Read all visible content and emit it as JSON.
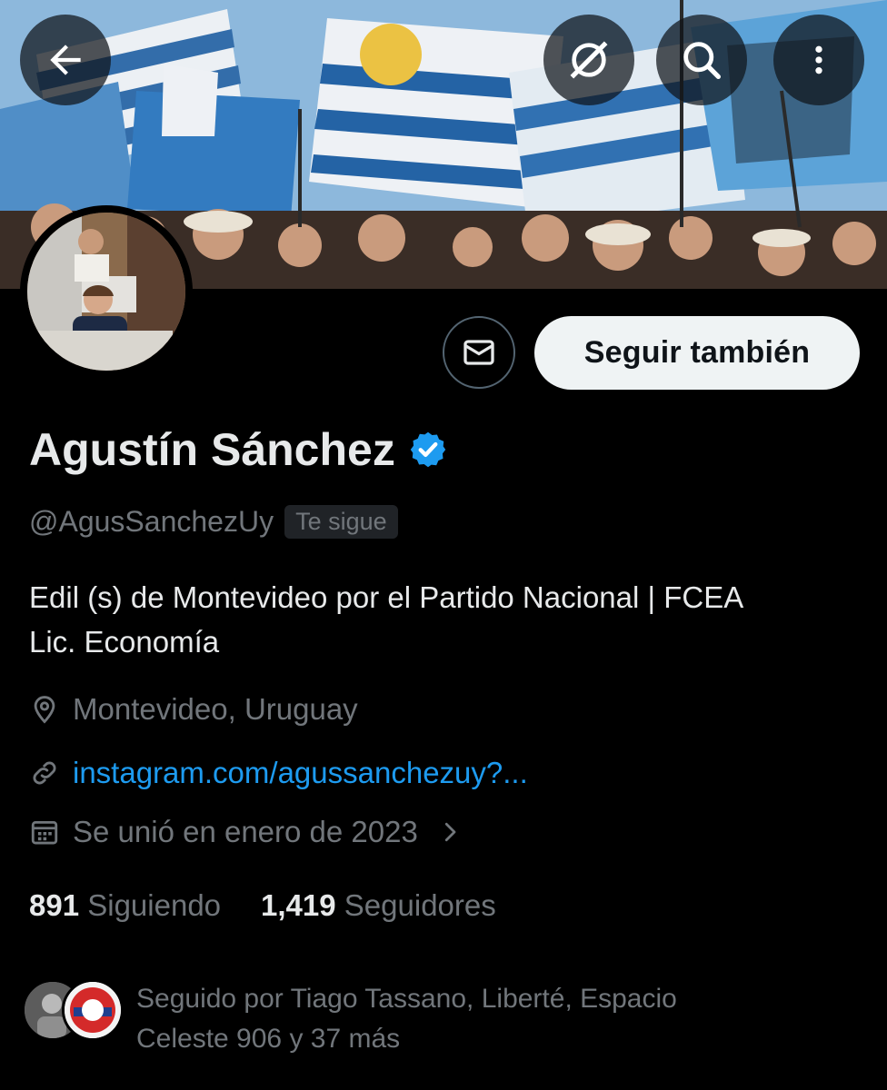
{
  "header": {
    "back_icon": "arrow-left-icon",
    "grok_icon": "grok-icon",
    "search_icon": "search-icon",
    "more_icon": "more-vertical-icon"
  },
  "profile": {
    "name": "Agustín Sánchez",
    "verified": true,
    "handle": "@AgusSanchezUy",
    "follows_you_badge": "Te sigue",
    "bio_line1": "Edil (s) de Montevideo por el Partido Nacional | FCEA",
    "bio_line2": "Lic. Economía",
    "location": "Montevideo, Uruguay",
    "website": "instagram.com/agussanchezuy?...",
    "joined": "Se unió en enero de 2023"
  },
  "actions": {
    "follow_label": "Seguir también",
    "message_icon": "envelope-icon"
  },
  "stats": {
    "following_count": "891",
    "following_label": "Siguiendo",
    "followers_count": "1,419",
    "followers_label": "Seguidores"
  },
  "followed_by": {
    "line1": "Seguido por Tiago Tassano, Liberté, Espacio",
    "line2": "Celeste 906 y 37 más"
  },
  "colors": {
    "accent": "#1d9bf0",
    "background": "#000000",
    "muted": "#71767b",
    "text": "#e7e9ea"
  }
}
